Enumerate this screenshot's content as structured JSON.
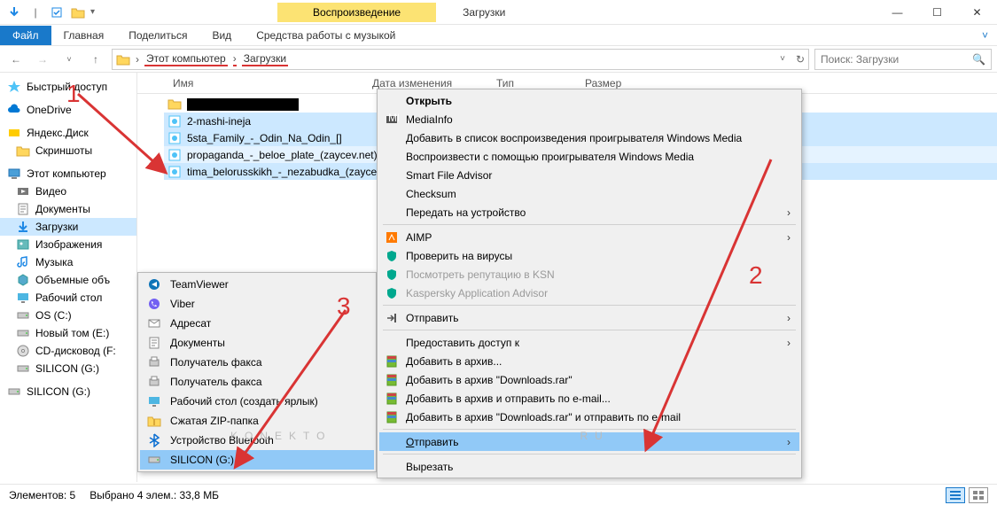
{
  "title_tab": "Воспроизведение",
  "window_title": "Загрузки",
  "ribbon": {
    "file": "Файл",
    "home": "Главная",
    "share": "Поделиться",
    "view": "Вид",
    "music": "Средства работы с музыкой"
  },
  "breadcrumb": [
    "Этот компьютер",
    "Загрузки"
  ],
  "search_placeholder": "Поиск: Загрузки",
  "columns": {
    "name": "Имя",
    "date": "Дата изменения",
    "type": "Тип",
    "size": "Размер"
  },
  "sidebar": [
    {
      "label": "Быстрый доступ",
      "icon": "star",
      "root": true
    },
    {
      "label": "OneDrive",
      "icon": "cloud",
      "root": true
    },
    {
      "label": "Яндекс.Диск",
      "icon": "ydisk",
      "root": true
    },
    {
      "label": "Скриншоты",
      "icon": "folder"
    },
    {
      "label": "Этот компьютер",
      "icon": "pc",
      "root": true
    },
    {
      "label": "Видео",
      "icon": "video"
    },
    {
      "label": "Документы",
      "icon": "docs"
    },
    {
      "label": "Загрузки",
      "icon": "down",
      "selected": true
    },
    {
      "label": "Изображения",
      "icon": "img"
    },
    {
      "label": "Музыка",
      "icon": "music"
    },
    {
      "label": "Объемные объ",
      "icon": "3d"
    },
    {
      "label": "Рабочий стол",
      "icon": "desk"
    },
    {
      "label": "OS (C:)",
      "icon": "hdd"
    },
    {
      "label": "Новый том (E:)",
      "icon": "hdd"
    },
    {
      "label": "CD-дисковод (F:",
      "icon": "cd"
    },
    {
      "label": "SILICON (G:)",
      "icon": "hdd"
    },
    {
      "label": "SILICON (G:)",
      "icon": "hdd",
      "root": true
    }
  ],
  "files": [
    {
      "name": "",
      "icon": "folder",
      "sel": false,
      "redact": true
    },
    {
      "name": "2-mashi-ineja",
      "icon": "wma",
      "sel": true
    },
    {
      "name": "5sta_Family_-_Odin_Na_Odin_[]",
      "icon": "wma",
      "sel": true
    },
    {
      "name": "propaganda_-_beloe_plate_(zaycev.net)",
      "icon": "wma",
      "sel": true,
      "hov": true
    },
    {
      "name": "tima_belorusskikh_-_nezabudka_(zaycev...",
      "icon": "wma",
      "sel": true
    }
  ],
  "context": [
    {
      "label": "Открыть",
      "bold": true
    },
    {
      "label": "MediaInfo",
      "icon": "mi"
    },
    {
      "label": "Добавить в список воспроизведения проигрывателя Windows Media"
    },
    {
      "label": "Воспроизвести с помощью проигрывателя Windows Media"
    },
    {
      "label": "Smart File Advisor"
    },
    {
      "label": "Checksum"
    },
    {
      "label": "Передать на устройство",
      "arrow": true
    },
    {
      "sep": true
    },
    {
      "label": "AIMP",
      "icon": "aimp",
      "arrow": true
    },
    {
      "label": "Проверить на вирусы",
      "icon": "kasp"
    },
    {
      "label": "Посмотреть репутацию в KSN",
      "icon": "kasp",
      "dis": true
    },
    {
      "label": "Kaspersky Application Advisor",
      "icon": "kasp",
      "dis": true
    },
    {
      "sep": true
    },
    {
      "label": "Отправить",
      "icon": "share",
      "arrow": true
    },
    {
      "sep": true
    },
    {
      "label": "Предоставить доступ к",
      "arrow": true
    },
    {
      "label": "Добавить в архив...",
      "icon": "rar"
    },
    {
      "label": "Добавить в архив \"Downloads.rar\"",
      "icon": "rar"
    },
    {
      "label": "Добавить в архив и отправить по e-mail...",
      "icon": "rar"
    },
    {
      "label": "Добавить в архив \"Downloads.rar\" и отправить по e-mail",
      "icon": "rar"
    },
    {
      "sep": true
    },
    {
      "label": "Отправить",
      "arrow": true,
      "sel": true,
      "underline": true
    },
    {
      "sep": true
    },
    {
      "label": "Вырезать"
    }
  ],
  "submenu": [
    {
      "label": "TeamViewer",
      "icon": "tv"
    },
    {
      "label": "Viber",
      "icon": "viber"
    },
    {
      "label": "Адресат",
      "icon": "mail"
    },
    {
      "label": "Документы",
      "icon": "docs"
    },
    {
      "label": "Получатель факса",
      "icon": "fax"
    },
    {
      "label": "Получатель факса",
      "icon": "fax"
    },
    {
      "label": "Рабочий стол (создать ярлык)",
      "icon": "desk"
    },
    {
      "label": "Сжатая ZIP-папка",
      "icon": "zip"
    },
    {
      "label": "Устройство Bluetooth",
      "icon": "bt"
    },
    {
      "label": "SILICON (G:)",
      "icon": "hdd",
      "sel": true
    }
  ],
  "status": {
    "count": "Элементов: 5",
    "selected": "Выбрано 4 элем.: 33,8 МБ"
  },
  "annotations": {
    "a1": "1",
    "a2": "2",
    "a3": "3"
  },
  "watermark_left": "KONEKTO",
  "watermark_right": "RU"
}
